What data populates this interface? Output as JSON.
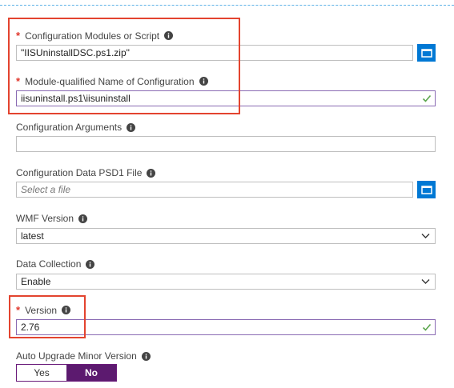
{
  "form": {
    "config_script": {
      "label": "Configuration Modules or Script",
      "value": "\"IISUninstallDSC.ps1.zip\"",
      "required": true
    },
    "module_name": {
      "label": "Module-qualified Name of Configuration",
      "value": "iisuninstall.ps1\\iisuninstall",
      "required": true
    },
    "config_args": {
      "label": "Configuration Arguments",
      "value": ""
    },
    "config_data": {
      "label": "Configuration Data PSD1 File",
      "placeholder": "Select a file"
    },
    "wmf_version": {
      "label": "WMF Version",
      "value": "latest"
    },
    "data_collection": {
      "label": "Data Collection",
      "value": "Enable"
    },
    "version": {
      "label": "Version",
      "value": "2.76",
      "required": true
    },
    "auto_upgrade": {
      "label": "Auto Upgrade Minor Version",
      "yes_label": "Yes",
      "no_label": "No",
      "selected": "No"
    }
  },
  "required_marker": "*",
  "colors": {
    "accent": "#0078d4",
    "toggle_selected": "#5c1a6f",
    "highlight": "#e3442f",
    "valid_check": "#5ba64c",
    "required": "#e0362b"
  },
  "icons": {
    "info": "info-icon",
    "file_picker": "folder-icon",
    "valid": "check-icon",
    "dropdown": "chevron-down-icon"
  }
}
